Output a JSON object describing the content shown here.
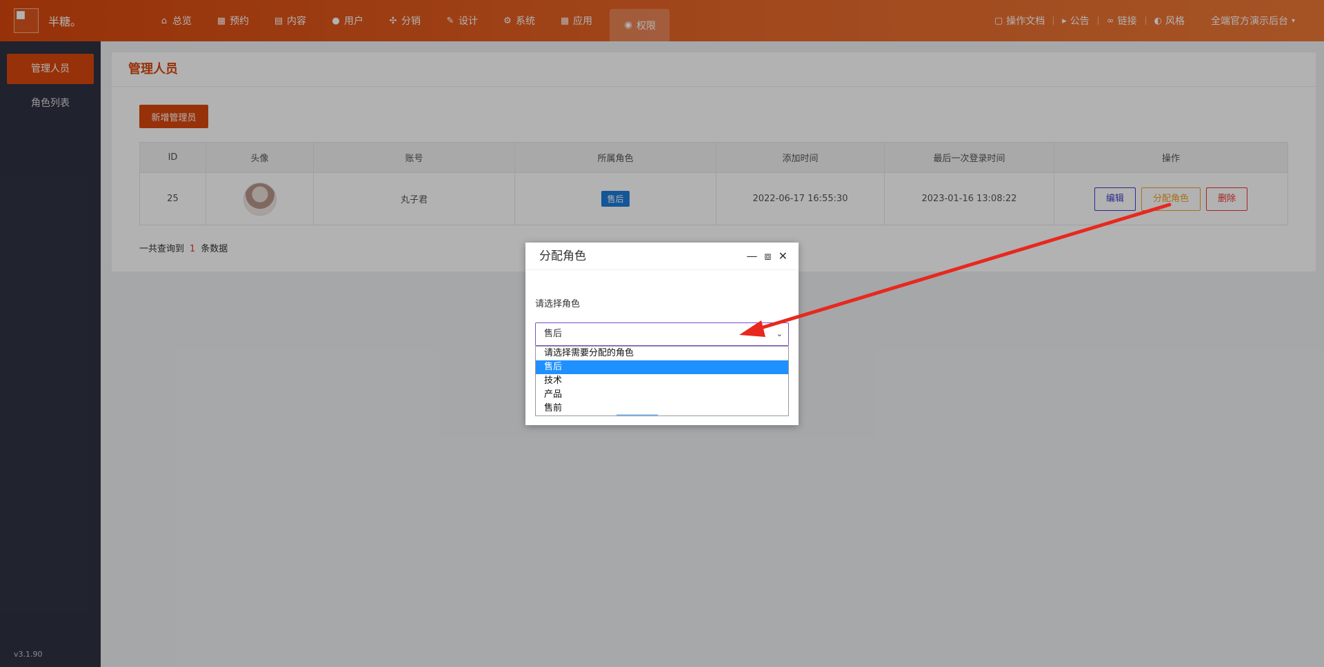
{
  "brand": "半糖。",
  "nav": {
    "items": [
      {
        "label": "总览",
        "icon": "home-icon",
        "glyph": "⌂"
      },
      {
        "label": "预约",
        "icon": "calendar-icon",
        "glyph": "▦"
      },
      {
        "label": "内容",
        "icon": "document-icon",
        "glyph": "▤"
      },
      {
        "label": "用户",
        "icon": "user-icon",
        "glyph": "●"
      },
      {
        "label": "分销",
        "icon": "share-icon",
        "glyph": "✣"
      },
      {
        "label": "设计",
        "icon": "brush-icon",
        "glyph": "✎"
      },
      {
        "label": "系统",
        "icon": "gear-icon",
        "glyph": "⚙"
      },
      {
        "label": "应用",
        "icon": "grid-icon",
        "glyph": "▦"
      },
      {
        "label": "权限",
        "icon": "lock-icon",
        "glyph": "🔒"
      }
    ],
    "active": "权限"
  },
  "right_tools": {
    "docs": "操作文档",
    "notice": "公告",
    "link": "链接",
    "style": "风格",
    "account": "全端官方演示后台"
  },
  "sidebar": {
    "items": [
      {
        "label": "管理人员"
      },
      {
        "label": "角色列表"
      }
    ],
    "version": "v3.1.90"
  },
  "page": {
    "title": "管理人员",
    "add_button": "新增管理员",
    "table": {
      "headers": [
        "ID",
        "头像",
        "账号",
        "所属角色",
        "添加时间",
        "最后一次登录时间",
        "操作"
      ],
      "rows": [
        {
          "id": "25",
          "account": "丸子君",
          "role": "售后",
          "added": "2022-06-17 16:55:30",
          "last_login": "2023-01-16 13:08:22"
        }
      ],
      "actions": {
        "edit": "编辑",
        "assign": "分配角色",
        "delete": "删除"
      }
    },
    "summary": {
      "prefix": "一共查询到",
      "count": "1",
      "suffix": "条数据"
    }
  },
  "dialog": {
    "title": "分配角色",
    "label": "请选择角色",
    "selected": "售后",
    "options": [
      "请选择需要分配的角色",
      "售后",
      "技术",
      "产品",
      "售前"
    ]
  },
  "colors": {
    "brand": "#d8470d",
    "select_highlight": "#1e90ff",
    "arrow": "#e8281e"
  }
}
